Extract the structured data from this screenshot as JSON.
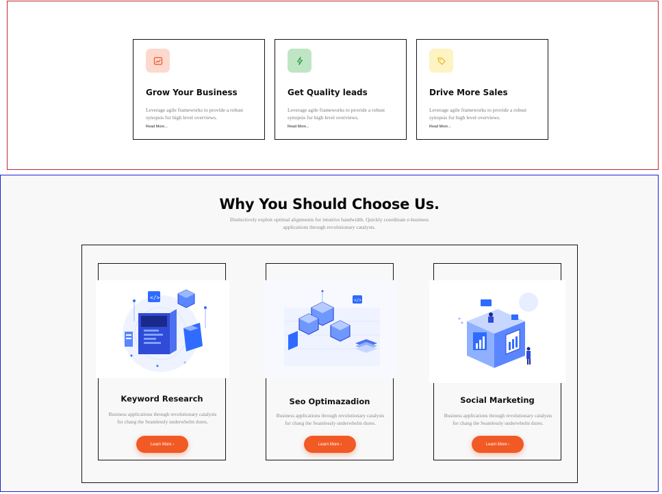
{
  "features": [
    {
      "title": "Grow Your Business",
      "description": "Leverage agile frameworks to provide a robust synopsis for high level overviews.",
      "link": "Read More...",
      "icon": "trending-chart-icon",
      "icon_bg": "#fdd9cd",
      "icon_color": "#e8542a"
    },
    {
      "title": "Get Quality leads",
      "description": "Leverage agile frameworks to provide a robust synopsis for high level overviews.",
      "link": "Read More...",
      "icon": "lightning-bolt-icon",
      "icon_bg": "#bfe6c4",
      "icon_color": "#2e9b46"
    },
    {
      "title": "Drive More Sales",
      "description": "Leverage agile frameworks to provide a robust synopsis for high level overviews.",
      "link": "Read More...",
      "icon": "price-tag-icon",
      "icon_bg": "#fdf3c3",
      "icon_color": "#e3b112"
    }
  ],
  "why": {
    "title": "Why You Should Choose Us.",
    "subtitle": "Distinctively exploit optimal alignments for intuitive bandwidth. Quickly coordinate e-business applications through revolutionary catalysts."
  },
  "services": [
    {
      "title": "Keyword Research",
      "description": "Business applications through revolutionary catalysts for chang the Seamlessly underwhelm dures.",
      "button": "Learn More ›",
      "illustration": "keyword-research-illustration"
    },
    {
      "title": "Seo Optimazadion",
      "description": "Business applications through revolutionary catalysts for chang the Seamlessly underwhelm dures.",
      "button": "Learn More ›",
      "illustration": "seo-cubes-illustration"
    },
    {
      "title": "Social Marketing",
      "description": "Business applications through revolutionary catalysts for chang the Seamlessly underwhelm dures.",
      "button": "Learn More ›",
      "illustration": "social-marketing-illustration"
    }
  ],
  "colors": {
    "accent": "#f15a24",
    "top_border": "#c2272d",
    "bottom_border": "#1d1fd0",
    "illustration_blue": "#2f6bff"
  }
}
